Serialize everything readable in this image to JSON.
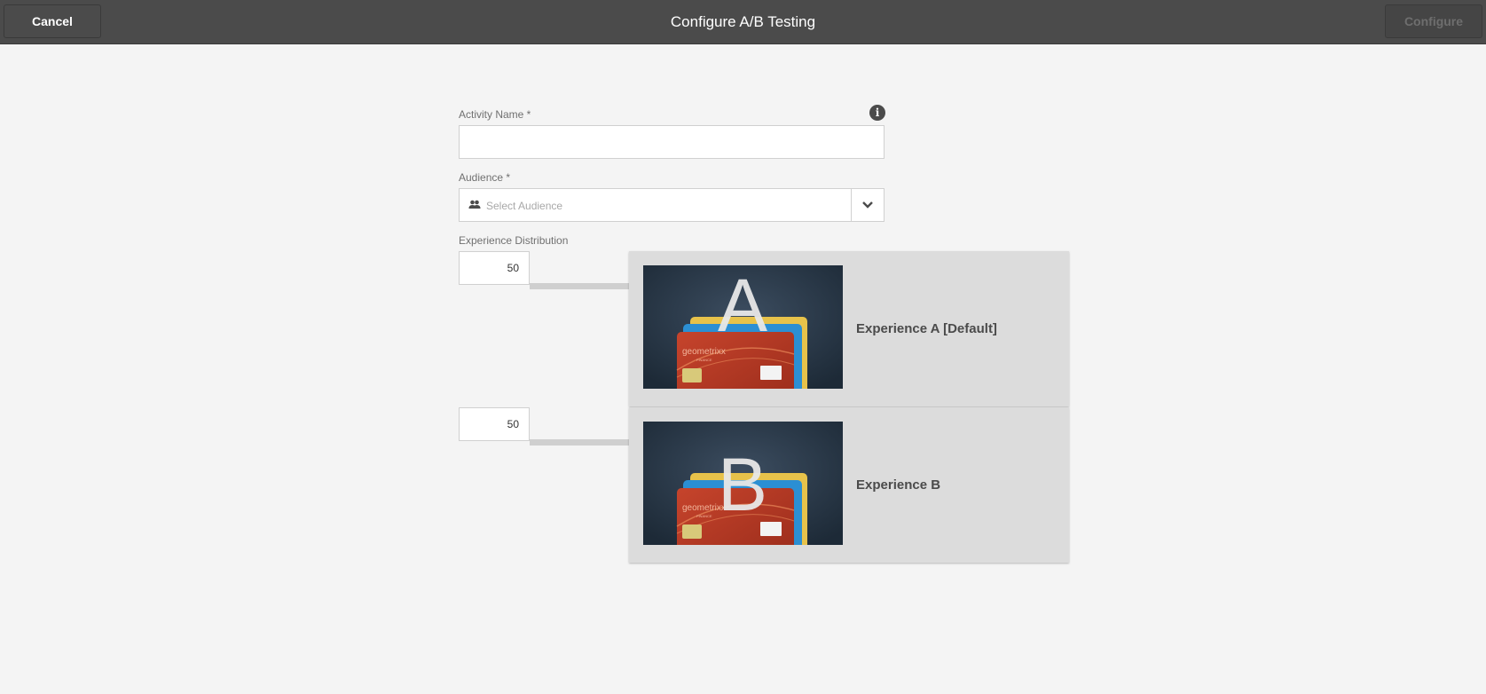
{
  "header": {
    "cancel_label": "Cancel",
    "title": "Configure A/B Testing",
    "configure_label": "Configure"
  },
  "form": {
    "activity_name": {
      "label": "Activity Name *",
      "value": ""
    },
    "audience": {
      "label": "Audience *",
      "placeholder": "Select Audience"
    },
    "distribution": {
      "label": "Experience Distribution"
    }
  },
  "experiences": [
    {
      "weight": "50",
      "letter": "A",
      "name": "Experience A [Default]",
      "card_brand": "geometrixx",
      "card_sub": "FINANCE"
    },
    {
      "weight": "50",
      "letter": "B",
      "name": "Experience B",
      "card_brand": "geometrixx",
      "card_sub": "FINANCE"
    }
  ],
  "icons": {
    "info": "info-icon",
    "audience": "people-icon",
    "dropdown": "chevron-down-icon"
  },
  "colors": {
    "topbar": "#4b4b4b",
    "background": "#f4f4f4",
    "card": "#dcdcdc"
  }
}
